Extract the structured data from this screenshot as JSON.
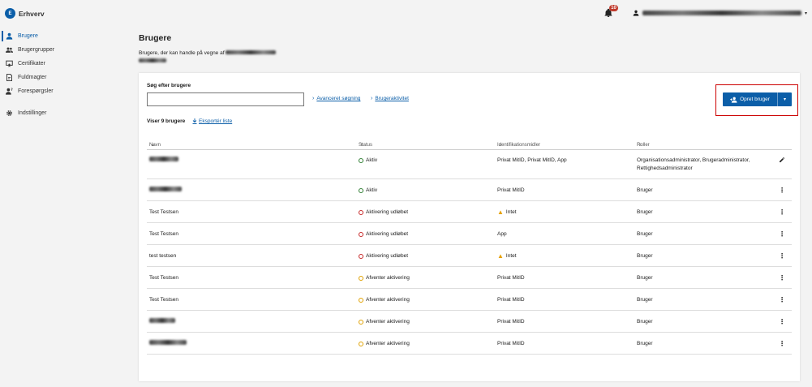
{
  "app": {
    "logo_initials": "E",
    "name": "Erhverv"
  },
  "topbar": {
    "notification_count": "10"
  },
  "sidebar": {
    "items": [
      {
        "label": "Brugere",
        "icon": "user-icon",
        "active": true
      },
      {
        "label": "Brugergrupper",
        "icon": "users-icon",
        "active": false
      },
      {
        "label": "Certifikater",
        "icon": "certificate-icon",
        "active": false
      },
      {
        "label": "Fuldmagter",
        "icon": "document-icon",
        "active": false
      },
      {
        "label": "Forespørgsler",
        "icon": "user-question-icon",
        "active": false
      },
      {
        "label": "Indstillinger",
        "icon": "gear-icon",
        "active": false
      }
    ]
  },
  "page": {
    "title": "Brugere",
    "subtitle": "Brugere, der kan handle på vegne af"
  },
  "search": {
    "label": "Søg efter brugere",
    "value": "",
    "placeholder": "",
    "advanced_link": "Avanceret søgning",
    "activity_link": "Brugeraktivitet"
  },
  "create_button": {
    "label": "Opret bruger"
  },
  "list": {
    "count_label": "Viser 9 brugere",
    "export_label": "Eksportér liste"
  },
  "table": {
    "headers": {
      "name": "Navn",
      "status": "Status",
      "id": "Identifikationsmidler",
      "roles": "Roller"
    },
    "rows": [
      {
        "name": "",
        "blurred": true,
        "status": "Aktiv",
        "status_color": "#2e7d32",
        "id": "Privat MitID, Privat MitID, App",
        "id_warn": false,
        "roles": "Organisationsadministrator, Brugeradministrator, Rettighedsadministrator",
        "action": "edit"
      },
      {
        "name": "",
        "blurred": true,
        "status": "Aktiv",
        "status_color": "#2e7d32",
        "id": "Privat MitID",
        "id_warn": false,
        "roles": "Bruger",
        "action": "more"
      },
      {
        "name": "Test Testsen",
        "blurred": false,
        "status": "Aktivering udløbet",
        "status_color": "#c62828",
        "id": "Intet",
        "id_warn": true,
        "roles": "Bruger",
        "action": "more"
      },
      {
        "name": "Test Testsen",
        "blurred": false,
        "status": "Aktivering udløbet",
        "status_color": "#c62828",
        "id": "App",
        "id_warn": false,
        "roles": "Bruger",
        "action": "more"
      },
      {
        "name": "test testsen",
        "blurred": false,
        "status": "Aktivering udløbet",
        "status_color": "#c62828",
        "id": "Intet",
        "id_warn": true,
        "roles": "Bruger",
        "action": "more"
      },
      {
        "name": "Test Testsen",
        "blurred": false,
        "status": "Afventer aktivering",
        "status_color": "#e0a100",
        "id": "Privat MitID",
        "id_warn": false,
        "roles": "Bruger",
        "action": "more"
      },
      {
        "name": "Test Testsen",
        "blurred": false,
        "status": "Afventer aktivering",
        "status_color": "#e0a100",
        "id": "Privat MitID",
        "id_warn": false,
        "roles": "Bruger",
        "action": "more"
      },
      {
        "name": "",
        "blurred": true,
        "status": "Afventer aktivering",
        "status_color": "#e0a100",
        "id": "Privat MitID",
        "id_warn": false,
        "roles": "Bruger",
        "action": "more"
      },
      {
        "name": "",
        "blurred": true,
        "status": "Afventer aktivering",
        "status_color": "#e0a100",
        "id": "Privat MitID",
        "id_warn": false,
        "roles": "Bruger",
        "action": "more"
      }
    ]
  },
  "colors": {
    "accent": "#0b5ea8",
    "highlight_border": "#cc0000",
    "badge": "#c0392b"
  }
}
